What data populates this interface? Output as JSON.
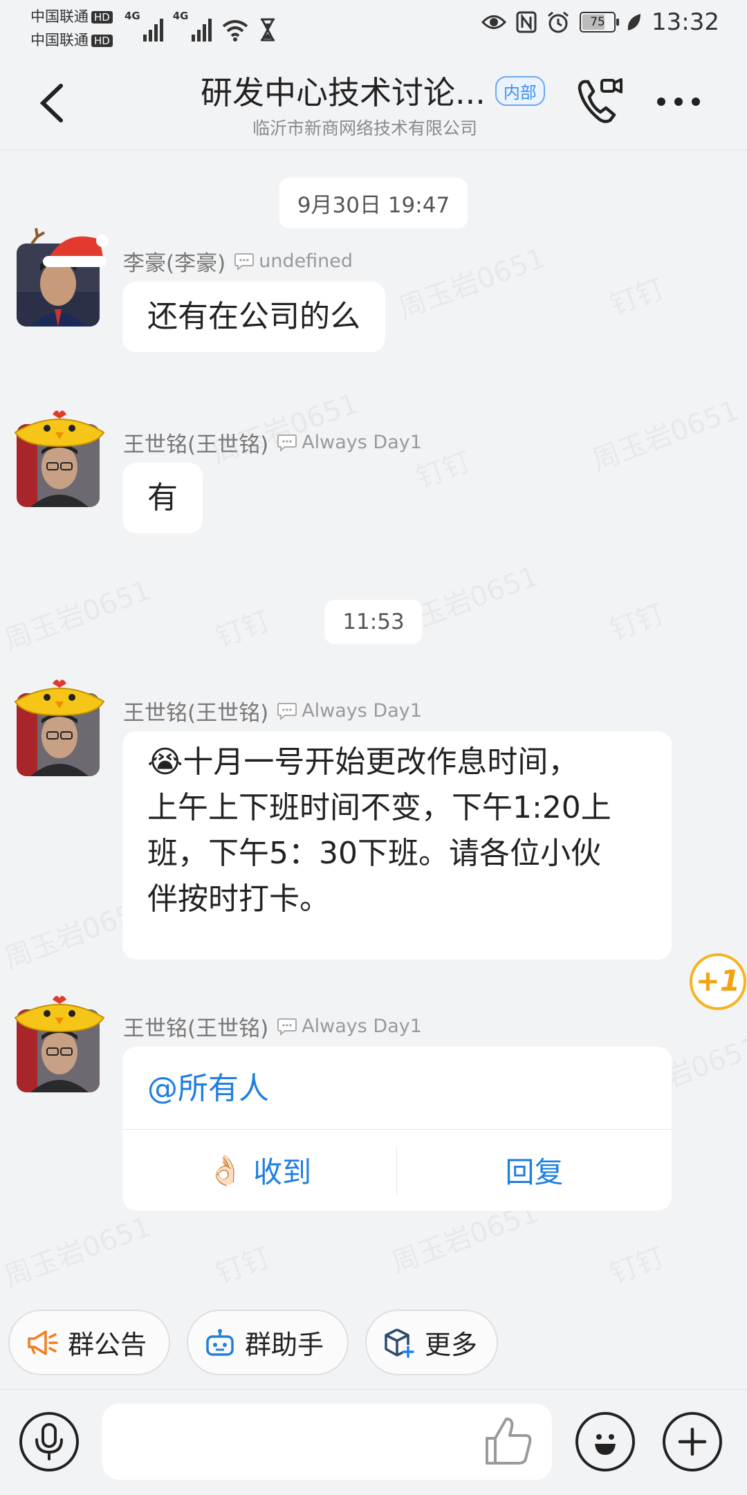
{
  "status_bar": {
    "carrier1": "中国联通",
    "carrier2": "中国联通",
    "hd": "HD",
    "network1": "4G",
    "network2": "4G",
    "battery": "75",
    "battery_level": 0.75,
    "time": "13:32"
  },
  "header": {
    "title": "研发中心技术讨论...",
    "badge": "内部",
    "subtitle": "临沂市新商网络技术有限公司"
  },
  "watermark": [
    "周玉岩0651",
    "钉钉"
  ],
  "timestamps": [
    "9月30日 19:47",
    "11:53"
  ],
  "messages": [
    {
      "sender": "李豪(李豪)",
      "signature": "undefined",
      "text": "还有在公司的么"
    },
    {
      "sender": "王世铭(王世铭)",
      "signature": "Always Day1",
      "text": "有"
    },
    {
      "sender": "王世铭(王世铭)",
      "signature": "Always Day1",
      "emoji": "😭",
      "lines": [
        "十月一号开始更改作息时间，",
        "上午上下班时间不变，下午1:20上",
        "班，下午5：30下班。请各位小伙",
        "伴按时打卡。"
      ]
    },
    {
      "sender": "王世铭(王世铭)",
      "signature": "Always Day1",
      "mention": "@所有人",
      "ack_emoji": "👌🏻",
      "ack_label": "收到",
      "reply_label": "回复"
    }
  ],
  "plus_one": "+1",
  "quick_actions": [
    {
      "label": "群公告",
      "icon": "megaphone-icon",
      "color": "#f07e1c"
    },
    {
      "label": "群助手",
      "icon": "robot-icon",
      "color": "#1e7fe2"
    },
    {
      "label": "更多",
      "icon": "cube-icon",
      "color": "#2d4a6b"
    }
  ],
  "input": {
    "placeholder": ""
  }
}
